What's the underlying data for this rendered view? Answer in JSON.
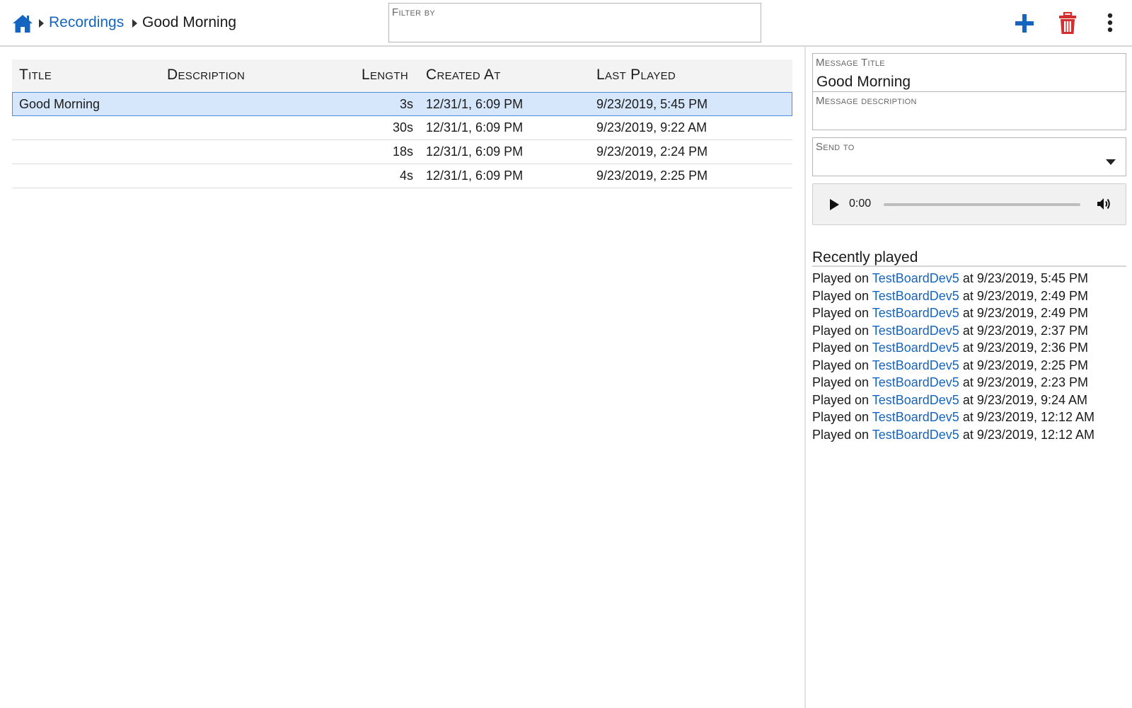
{
  "colors": {
    "accent": "#1565c0",
    "delete": "#d32f2f",
    "selected_row": "#d7e7fb",
    "header_bg": "#f3f3f3"
  },
  "icons": {
    "home": "home-icon",
    "add": "plus-icon",
    "delete": "trash-icon",
    "more": "more-vertical-icon",
    "breadcrumb_separator": "chevron-right-icon",
    "dropdown": "caret-down-icon",
    "play": "play-icon",
    "volume": "volume-icon"
  },
  "breadcrumb": {
    "items": [
      {
        "label": "Recordings"
      },
      {
        "label": "Good Morning"
      }
    ]
  },
  "filter": {
    "label": "Filter by",
    "value": ""
  },
  "table": {
    "columns": [
      "Title",
      "Description",
      "Length",
      "Created At",
      "Last Played"
    ],
    "rows": [
      {
        "title": "Good Morning",
        "description": "",
        "length": "3s",
        "created": "12/31/1, 6:09 PM",
        "last_played": "9/23/2019, 5:45 PM",
        "selected": true
      },
      {
        "title": "",
        "description": "",
        "length": "30s",
        "created": "12/31/1, 6:09 PM",
        "last_played": "9/23/2019, 9:22 AM",
        "selected": false
      },
      {
        "title": "",
        "description": "",
        "length": "18s",
        "created": "12/31/1, 6:09 PM",
        "last_played": "9/23/2019, 2:24 PM",
        "selected": false
      },
      {
        "title": "",
        "description": "",
        "length": "4s",
        "created": "12/31/1, 6:09 PM",
        "last_played": "9/23/2019, 2:25 PM",
        "selected": false
      }
    ]
  },
  "details": {
    "title_label": "Message Title",
    "title_value": "Good Morning",
    "description_label": "Message description",
    "description_value": "",
    "send_to_label": "Send to",
    "send_to_value": ""
  },
  "player": {
    "time": "0:00",
    "progress": 0
  },
  "recent": {
    "heading": "Recently played",
    "prefix": "Played on",
    "connector": "at",
    "items": [
      {
        "device": "TestBoardDev5",
        "time": "9/23/2019, 5:45 PM"
      },
      {
        "device": "TestBoardDev5",
        "time": "9/23/2019, 2:49 PM"
      },
      {
        "device": "TestBoardDev5",
        "time": "9/23/2019, 2:49 PM"
      },
      {
        "device": "TestBoardDev5",
        "time": "9/23/2019, 2:37 PM"
      },
      {
        "device": "TestBoardDev5",
        "time": "9/23/2019, 2:36 PM"
      },
      {
        "device": "TestBoardDev5",
        "time": "9/23/2019, 2:25 PM"
      },
      {
        "device": "TestBoardDev5",
        "time": "9/23/2019, 2:23 PM"
      },
      {
        "device": "TestBoardDev5",
        "time": "9/23/2019, 9:24 AM"
      },
      {
        "device": "TestBoardDev5",
        "time": "9/23/2019, 12:12 AM"
      },
      {
        "device": "TestBoardDev5",
        "time": "9/23/2019, 12:12 AM"
      }
    ]
  }
}
